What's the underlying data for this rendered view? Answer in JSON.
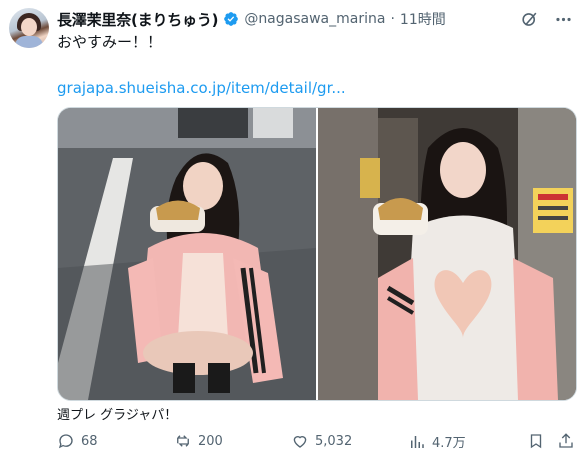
{
  "post": {
    "display_name": "長澤茉里奈(まりちゅう)",
    "handle": "@nagasawa_marina",
    "separator": "·",
    "time": "11時間",
    "text": "おやすみー！！",
    "link_text": "grajapa.shueisha.co.jp/item/detail/gr...",
    "caption": "週プレ グラジャパ！",
    "verified_color": "#1d9bf0"
  },
  "icons": {
    "grok": "grok-icon",
    "more": "more-icon",
    "reply": "reply-icon",
    "repost": "repost-icon",
    "like": "like-icon",
    "views": "views-icon",
    "bookmark": "bookmark-icon",
    "share": "share-icon"
  },
  "stats": {
    "replies": "68",
    "reposts": "200",
    "likes": "5,032",
    "views": "4.7万"
  },
  "colors": {
    "text": "#0f1419",
    "secondary": "#536471",
    "link": "#1d9bf0",
    "border": "#cfd9de"
  }
}
